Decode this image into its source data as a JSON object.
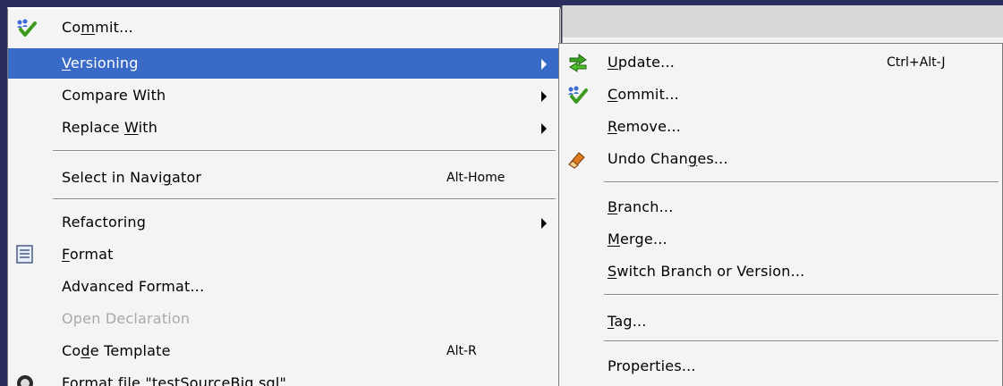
{
  "main_menu": {
    "commit": {
      "pre": "Co",
      "mn": "m",
      "post": "mit..."
    },
    "versioning": {
      "pre": "",
      "mn": "V",
      "post": "ersioning"
    },
    "compare_with": {
      "pre": "Compare With",
      "mn": "",
      "post": ""
    },
    "replace_with": {
      "pre": "Replace ",
      "mn": "W",
      "post": "ith"
    },
    "select_in_navigator": {
      "pre": "Select in Navi",
      "mn": "g",
      "post": "ator",
      "shortcut": "Alt-Home"
    },
    "refactoring": {
      "pre": "Refactoring",
      "mn": "",
      "post": ""
    },
    "format": {
      "pre": "",
      "mn": "F",
      "post": "ormat"
    },
    "advanced_format": {
      "pre": "Advanced Format...",
      "mn": "",
      "post": ""
    },
    "open_declaration": {
      "pre": "Open Declaration",
      "mn": "",
      "post": ""
    },
    "code_template": {
      "pre": "Co",
      "mn": "d",
      "post": "e Template",
      "shortcut": "Alt-R"
    },
    "format_file": {
      "pre": "Format file \"testSourceBig.sql\"",
      "mn": "",
      "post": ""
    }
  },
  "sub_menu": {
    "update": {
      "pre": "",
      "mn": "U",
      "post": "pdate...",
      "shortcut": "Ctrl+Alt-J"
    },
    "commit": {
      "pre": "",
      "mn": "C",
      "post": "ommit..."
    },
    "remove": {
      "pre": "",
      "mn": "R",
      "post": "emove..."
    },
    "undo_changes": {
      "pre": "Undo Chan",
      "mn": "g",
      "post": "es..."
    },
    "branch": {
      "pre": "",
      "mn": "B",
      "post": "ranch..."
    },
    "merge": {
      "pre": "",
      "mn": "M",
      "post": "erge..."
    },
    "switch_branch": {
      "pre": "",
      "mn": "S",
      "post": "witch Branch or Version..."
    },
    "tag": {
      "pre": "",
      "mn": "T",
      "post": "ag..."
    },
    "properties": {
      "pre": "Properties...",
      "mn": "",
      "post": ""
    }
  },
  "colors": {
    "selection": "#3a6ac8",
    "background": "#2b2d5c",
    "menu_bg": "#f4f4f4",
    "disabled_text": "#a9a9a9"
  },
  "icons": {
    "commit": "commit-users-check-icon",
    "update": "update-green-arrows-icon",
    "undo": "undo-eraser-icon",
    "format": "format-document-icon",
    "format_file": "format-file-icon"
  }
}
